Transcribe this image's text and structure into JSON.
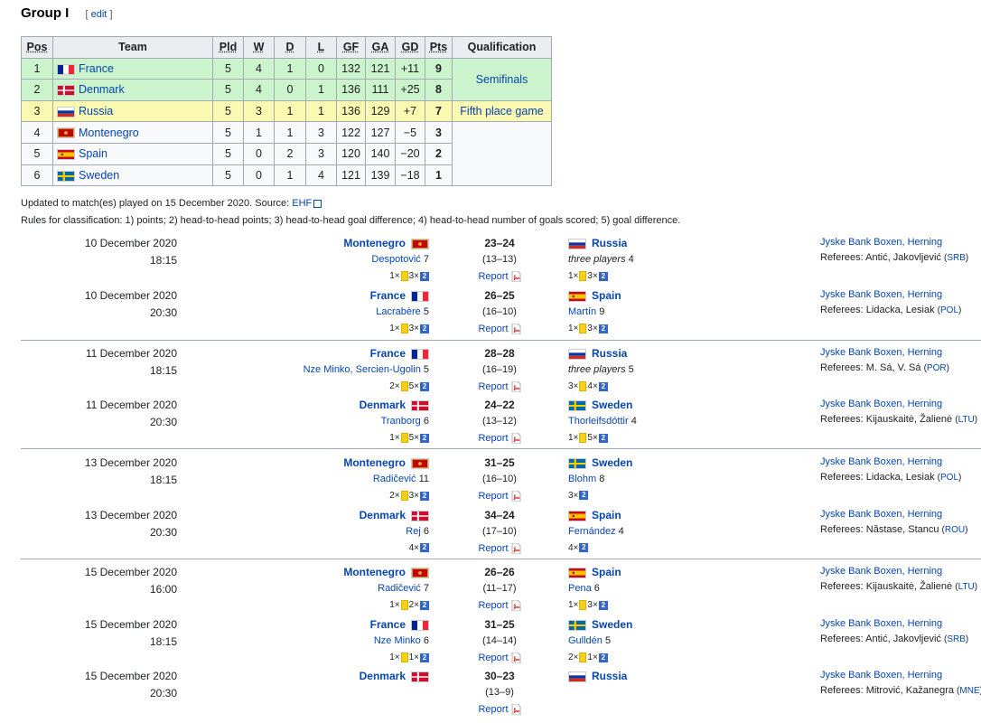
{
  "heading": {
    "title": "Group I",
    "edit_open": "[",
    "edit_label": "edit",
    "edit_close": "]"
  },
  "table": {
    "headers": [
      "Pos",
      "Team",
      "Pld",
      "W",
      "D",
      "L",
      "GF",
      "GA",
      "GD",
      "Pts",
      "Qualification"
    ],
    "rows": [
      {
        "pos": "1",
        "team": "France",
        "flag": "france",
        "pld": "5",
        "w": "4",
        "d": "1",
        "l": "0",
        "gf": "132",
        "ga": "121",
        "gd": "+11",
        "pts": "9"
      },
      {
        "pos": "2",
        "team": "Denmark",
        "flag": "denmark",
        "pld": "5",
        "w": "4",
        "d": "0",
        "l": "1",
        "gf": "136",
        "ga": "111",
        "gd": "+25",
        "pts": "8"
      },
      {
        "pos": "3",
        "team": "Russia",
        "flag": "russia",
        "pld": "5",
        "w": "3",
        "d": "1",
        "l": "1",
        "gf": "136",
        "ga": "129",
        "gd": "+7",
        "pts": "7"
      },
      {
        "pos": "4",
        "team": "Montenegro",
        "flag": "montenegro",
        "pld": "5",
        "w": "1",
        "d": "1",
        "l": "3",
        "gf": "122",
        "ga": "127",
        "gd": "−5",
        "pts": "3"
      },
      {
        "pos": "5",
        "team": "Spain",
        "flag": "spain",
        "pld": "5",
        "w": "0",
        "d": "2",
        "l": "3",
        "gf": "120",
        "ga": "140",
        "gd": "−20",
        "pts": "2"
      },
      {
        "pos": "6",
        "team": "Sweden",
        "flag": "sweden",
        "pld": "5",
        "w": "0",
        "d": "1",
        "l": "4",
        "gf": "121",
        "ga": "139",
        "gd": "−18",
        "pts": "1"
      }
    ],
    "qualification": {
      "semifinals": "Semifinals",
      "fifth": "Fifth place game"
    }
  },
  "notes": {
    "updated_prefix": "Updated to match(es) played on 15 December 2020. Source: ",
    "source_link": "EHF",
    "rules": "Rules for classification: 1) points; 2) head-to-head points; 3) head-to-head goal difference; 4) head-to-head number of goals scored; 5) goal difference."
  },
  "colors": {
    "green": "#ccf4cc",
    "yellow": "#fbf8b2",
    "link": "#0645ad"
  },
  "matches": [
    {
      "date": "10 December 2020",
      "time": "18:15",
      "home": "Montenegro",
      "home_flag": "montenegro",
      "home_scorer": "Despotović",
      "home_goals": "7",
      "home_yellow": "1×",
      "home_susp": "3×",
      "score": "23–24",
      "half": "(13–13)",
      "report": "Report",
      "away": "Russia",
      "away_flag": "russia",
      "away_scorer": "three players",
      "away_goals": "4",
      "away_scorer_italic": true,
      "away_yellow": "1×",
      "away_susp": "3×",
      "venue": "Jyske Bank Boxen, Herning",
      "referees_label": "Referees:",
      "referees": "Antić, Jakovljević",
      "ref_country": "SRB"
    },
    {
      "date": "10 December 2020",
      "time": "20:30",
      "home": "France",
      "home_flag": "france",
      "home_scorer": "Lacrabère",
      "home_goals": "5",
      "home_yellow": "1×",
      "home_susp": "3×",
      "score": "26–25",
      "half": "(16–10)",
      "report": "Report",
      "away": "Spain",
      "away_flag": "spain",
      "away_scorer": "Martín",
      "away_goals": "9",
      "away_scorer_italic": false,
      "away_yellow": "1×",
      "away_susp": "3×",
      "venue": "Jyske Bank Boxen, Herning",
      "referees_label": "Referees:",
      "referees": "Lidacka, Lesiak",
      "ref_country": "POL"
    },
    {
      "date": "11 December 2020",
      "time": "18:15",
      "home": "France",
      "home_flag": "france",
      "home_scorer": "Nze Minko, Sercien-Ugolin",
      "home_goals": "5",
      "home_yellow": "2×",
      "home_susp": "5×",
      "score": "28–28",
      "half": "(16–19)",
      "report": "Report",
      "away": "Russia",
      "away_flag": "russia",
      "away_scorer": "three players",
      "away_goals": "5",
      "away_scorer_italic": true,
      "away_yellow": "3×",
      "away_susp": "4×",
      "venue": "Jyske Bank Boxen, Herning",
      "referees_label": "Referees:",
      "referees": "M. Sá, V. Sá",
      "ref_country": "POR"
    },
    {
      "date": "11 December 2020",
      "time": "20:30",
      "home": "Denmark",
      "home_flag": "denmark",
      "home_scorer": "Tranborg",
      "home_goals": "6",
      "home_yellow": "1×",
      "home_susp": "5×",
      "score": "24–22",
      "half": "(13–12)",
      "report": "Report",
      "away": "Sweden",
      "away_flag": "sweden",
      "away_scorer": "Thorleifsdóttir",
      "away_goals": "4",
      "away_scorer_italic": false,
      "away_yellow": "1×",
      "away_susp": "5×",
      "venue": "Jyske Bank Boxen, Herning",
      "referees_label": "Referees:",
      "referees": "Kijauskaitė, Žalienė",
      "ref_country": "LTU"
    },
    {
      "date": "13 December 2020",
      "time": "18:15",
      "home": "Montenegro",
      "home_flag": "montenegro",
      "home_scorer": "Radičević",
      "home_goals": "11",
      "home_yellow": "2×",
      "home_susp": "3×",
      "score": "31–25",
      "half": "(16–10)",
      "report": "Report",
      "away": "Sweden",
      "away_flag": "sweden",
      "away_scorer": "Blohm",
      "away_goals": "8",
      "away_scorer_italic": false,
      "away_yellow": "",
      "away_susp": "3×",
      "venue": "Jyske Bank Boxen, Herning",
      "referees_label": "Referees:",
      "referees": "Lidacka, Lesiak",
      "ref_country": "POL"
    },
    {
      "date": "13 December 2020",
      "time": "20:30",
      "home": "Denmark",
      "home_flag": "denmark",
      "home_scorer": "Rej",
      "home_goals": "6",
      "home_yellow": "",
      "home_susp": "4×",
      "score": "34–24",
      "half": "(17–10)",
      "report": "Report",
      "away": "Spain",
      "away_flag": "spain",
      "away_scorer": "Fernández",
      "away_goals": "4",
      "away_scorer_italic": false,
      "away_yellow": "",
      "away_susp": "4×",
      "venue": "Jyske Bank Boxen, Herning",
      "referees_label": "Referees:",
      "referees": "Năstase, Stancu",
      "ref_country": "ROU"
    },
    {
      "date": "15 December 2020",
      "time": "16:00",
      "home": "Montenegro",
      "home_flag": "montenegro",
      "home_scorer": "Radičević",
      "home_goals": "7",
      "home_yellow": "1×",
      "home_susp": "2×",
      "score": "26–26",
      "half": "(11–17)",
      "report": "Report",
      "away": "Spain",
      "away_flag": "spain",
      "away_scorer": "Pena",
      "away_goals": "6",
      "away_scorer_italic": false,
      "away_yellow": "1×",
      "away_susp": "3×",
      "venue": "Jyske Bank Boxen, Herning",
      "referees_label": "Referees:",
      "referees": "Kijauskaitė, Žalienė",
      "ref_country": "LTU"
    },
    {
      "date": "15 December 2020",
      "time": "18:15",
      "home": "France",
      "home_flag": "france",
      "home_scorer": "Nze Minko",
      "home_goals": "6",
      "home_yellow": "1×",
      "home_susp": "1×",
      "score": "31–25",
      "half": "(14–14)",
      "report": "Report",
      "away": "Sweden",
      "away_flag": "sweden",
      "away_scorer": "Gulldén",
      "away_goals": "5",
      "away_scorer_italic": false,
      "away_yellow": "2×",
      "away_susp": "1×",
      "venue": "Jyske Bank Boxen, Herning",
      "referees_label": "Referees:",
      "referees": "Antić, Jakovljević",
      "ref_country": "SRB"
    },
    {
      "date": "15 December 2020",
      "time": "20:30",
      "home": "Denmark",
      "home_flag": "denmark",
      "home_scorer": "",
      "home_goals": "",
      "home_yellow": "",
      "home_susp": "",
      "score": "30–23",
      "half": "(13–9)",
      "report": "Report",
      "away": "Russia",
      "away_flag": "russia",
      "away_scorer": "",
      "away_goals": "",
      "away_scorer_italic": false,
      "away_yellow": "",
      "away_susp": "",
      "venue": "Jyske Bank Boxen, Herning",
      "referees_label": "Referees:",
      "referees": "Mitrović, Kažanegra",
      "ref_country": "MNE"
    }
  ],
  "suspension_symbol": "2"
}
